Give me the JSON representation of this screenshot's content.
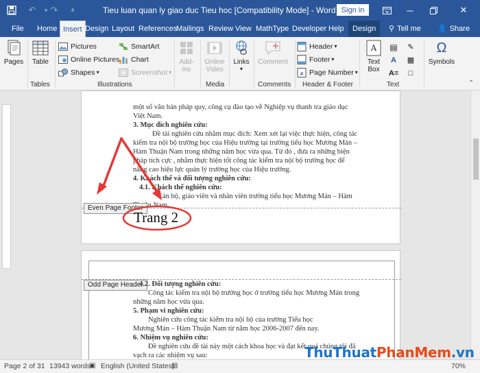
{
  "titlebar": {
    "title": "Tieu luan quan ly giao duc Tieu hoc [Compatibility Mode]  -  Word",
    "sign_in": "Sign in"
  },
  "tabs": {
    "items": [
      "File",
      "Home",
      "Insert",
      "Design",
      "Layout",
      "References",
      "Mailings",
      "Review",
      "View",
      "MathType",
      "Developer",
      "Help"
    ],
    "active": "Insert",
    "contextual": "Design",
    "tell_me": "Tell me",
    "share": "Share"
  },
  "ribbon": {
    "pages": "Pages",
    "table": "Table",
    "pictures": "Pictures",
    "online_pictures": "Online Pictures",
    "shapes": "Shapes",
    "smartart": "SmartArt",
    "chart": "Chart",
    "screenshot": "Screenshot",
    "addins": "Add-ins",
    "online_video": "Online Video",
    "links": "Links",
    "comment": "Comment",
    "header": "Header",
    "footer": "Footer",
    "page_number": "Page Number",
    "text_box": "Text Box",
    "symbols": "Symbols",
    "groups": {
      "tables": "Tables",
      "illustrations": "Illustrations",
      "media": "Media",
      "comments": "Comments",
      "header_footer": "Header & Footer",
      "text": "Text"
    }
  },
  "document": {
    "page2_lines": [
      "một số văn bản pháp quy, công cụ đào tạo về Nghiệp vụ thanh tra giáo dục",
      "Việt Nam.",
      "3. Mục đích nghiên cứu:",
      "Đề tài nghiên cứu nhằm mục đích: Xem xét lại việc thực hiện, công tác",
      "kiểm tra nội bộ trường học của Hiệu trưởng tại trường tiểu học Mương Mán –",
      "Hàm Thuận Nam trong những năm học vừa qua. Từ đó , đưa ra những biện",
      "pháp tích cực , nhằm thực hiện tốt công tác kiểm tra nội bộ trường học để",
      "nâng cao hiệu lực quản lý trường học của Hiệu trưởng.",
      "4. Khách thể và đối tượng nghiên cứu:",
      "4.1. Khách thể nghiên cứu:",
      "Cán bộ, giáo viên và nhân viên trường tiểu học Mương Mán – Hàm",
      "Thuận Nam."
    ],
    "page3_lines": [
      "4.2. Đối tượng nghiên cứu:",
      "Công tác kiểm tra nội bộ trường học ở trường tiểu học Mương Mán trong",
      "những năm học vừa qua.",
      "5. Phạm vi nghiên cứu:",
      "Nghiên cứu công tác kiểm tra nội bộ của trường Tiểu học",
      "Mương Mán – Hàm Thuận Nam từ năm học 2006-2007 đến nay.",
      "6. Nhiệm vụ nghiên cứu:",
      "Đề nghiên cứu đề tài này một cách khoa học và đạt kết quả chúng tôi đã",
      "vạch ra các nhiệm vụ sau:"
    ],
    "footer_label": "Even Page Footer",
    "header_label": "Odd Page Header",
    "page_number_text": "Trang 2"
  },
  "statusbar": {
    "page": "Page 2 of 31",
    "words": "13943 words",
    "language": "English (United States)",
    "zoom": "70%"
  },
  "watermark": {
    "part1": "ThuThuat",
    "part2": "PhanMem",
    "part3": ".vn"
  }
}
